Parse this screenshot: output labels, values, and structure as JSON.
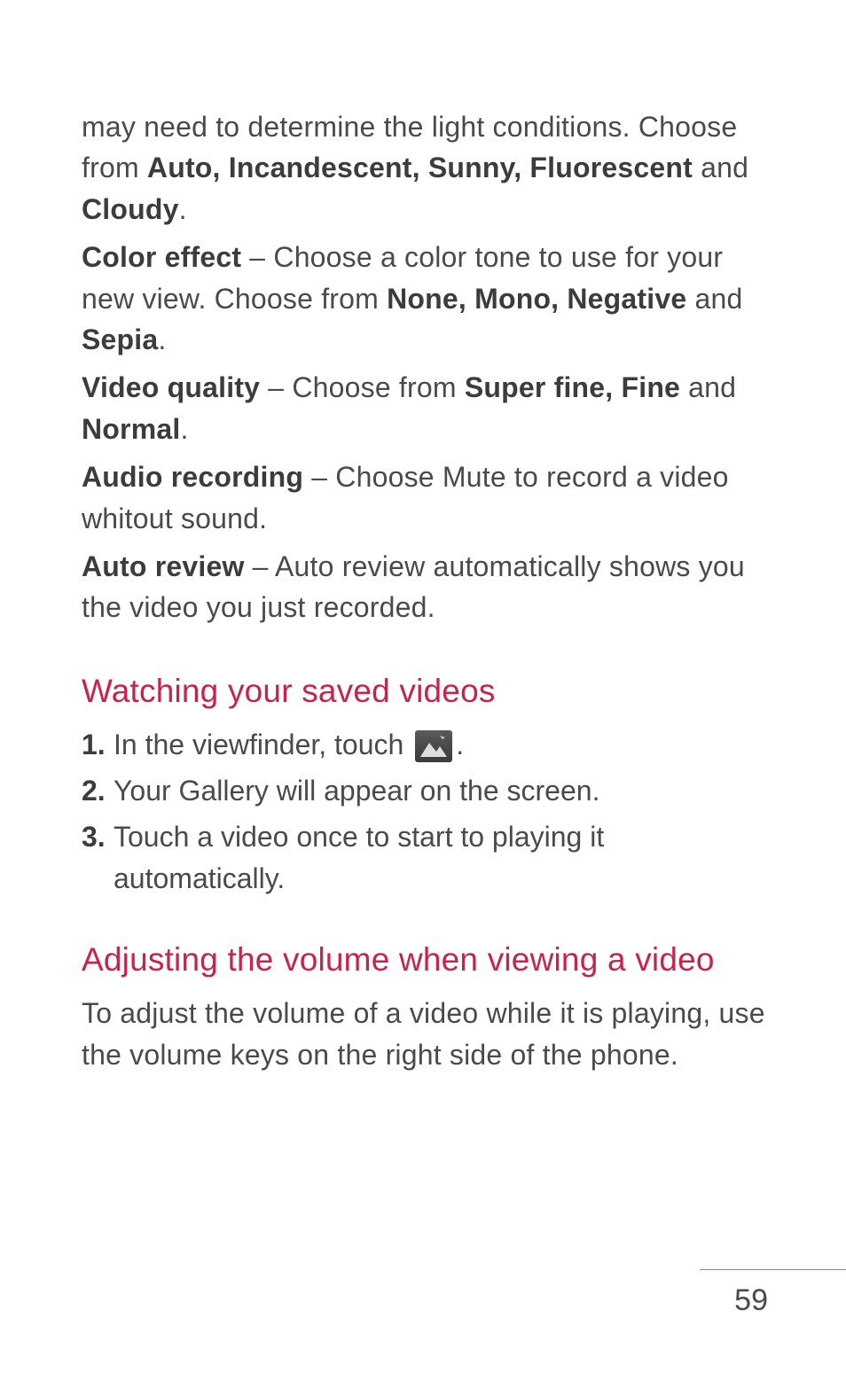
{
  "paragraphs": {
    "p1_a": "may need to determine the light conditions. Choose from ",
    "p1_b_bold": "Auto, Incandescent, Sunny, Fluorescent",
    "p1_c": " and ",
    "p1_d_bold": "Cloudy",
    "p1_e": ".",
    "p2_a_bold": "Color effect",
    "p2_b": " – Choose a color tone to use for your new view. Choose from ",
    "p2_c_bold": "None,  Mono, Negative",
    "p2_d": " and ",
    "p2_e_bold": "Sepia",
    "p2_f": ".",
    "p3_a_bold": "Video quality",
    "p3_b": " – Choose from ",
    "p3_c_bold": "Super fine, Fine",
    "p3_d": " and ",
    "p3_e_bold": "Normal",
    "p3_f": ".",
    "p4_a_bold": "Audio recording",
    "p4_b": " – Choose Mute to record a video whitout sound.",
    "p5_a_bold": "Auto review",
    "p5_b": " – Auto review automatically shows you the video you just recorded."
  },
  "headings": {
    "h1": "Watching your saved videos",
    "h2": "Adjusting the volume when viewing a video"
  },
  "list": {
    "n1": "1.",
    "t1_a": " In the viewfinder, touch ",
    "t1_b": ".",
    "n2": "2.",
    "t2": " Your Gallery will appear on the screen.",
    "n3": "3.",
    "t3": " Touch a video once to start to playing it automatically."
  },
  "adjusting_text": "To adjust the volume of a video while it is playing, use the volume keys on the right side of the phone.",
  "page_number": "59",
  "icon_name": "gallery-icon"
}
